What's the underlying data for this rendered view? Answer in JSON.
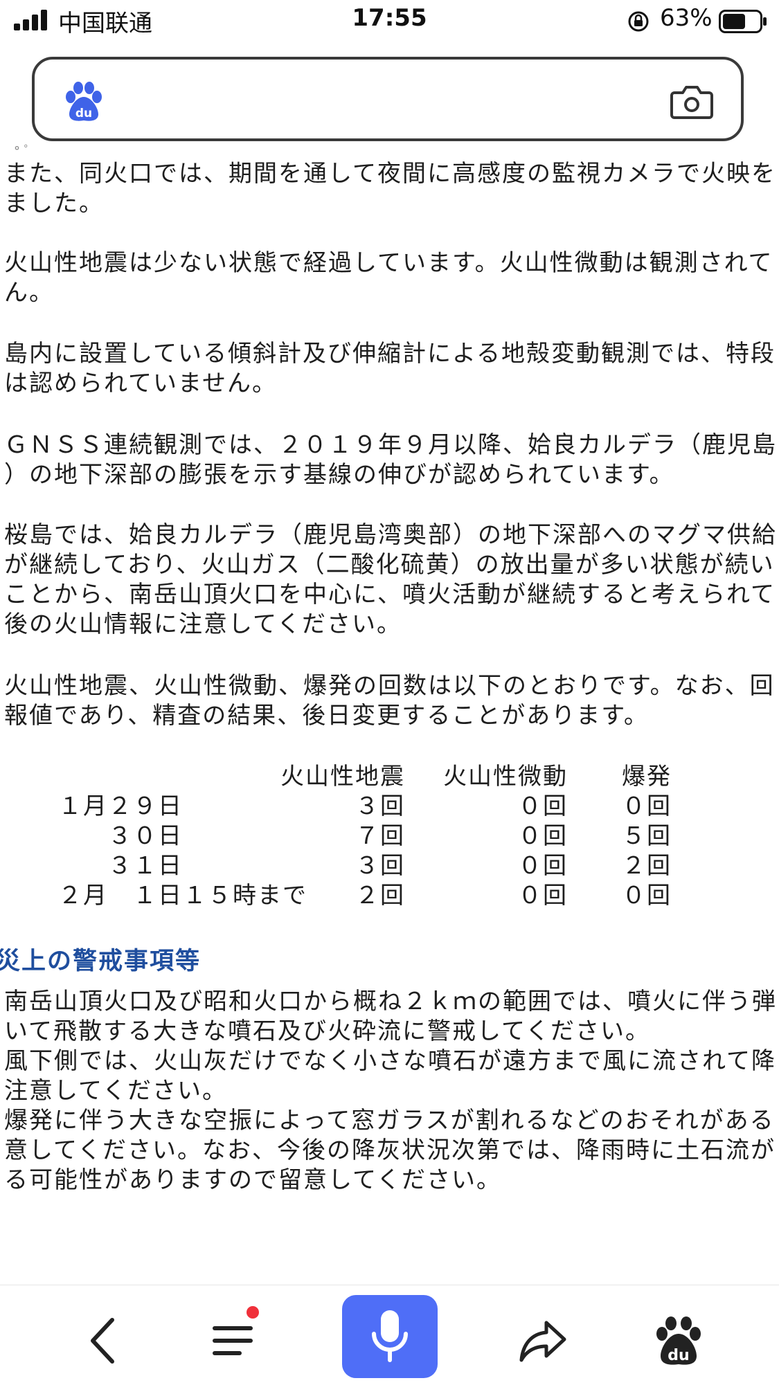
{
  "status_bar": {
    "carrier": "中国联通",
    "time": "17:55",
    "battery_percent": "63%",
    "battery_level": 0.63
  },
  "search": {
    "placeholder": ""
  },
  "content": {
    "paragraphs": [
      "また、同火口では、期間を通して夜間に高感度の監視カメラで火映を",
      "ました。",
      "火山性地震は少ない状態で経過しています。火山性微動は観測されて",
      "ん。",
      "島内に設置している傾斜計及び伸縮計による地殻変動観測では、特段",
      "は認められていません。",
      "ＧＮＳＳ連続観測では、２０１９年９月以降、姶良カルデラ（鹿児島",
      "）の地下深部の膨張を示す基線の伸びが認められています。",
      "桜島では、姶良カルデラ（鹿児島湾奥部）の地下深部へのマグマ供給",
      "が継続しており、火山ガス（二酸化硫黄）の放出量が多い状態が続い",
      "ことから、南岳山頂火口を中心に、噴火活動が継続すると考えられて",
      "後の火山情報に注意してください。",
      "火山性地震、火山性微動、爆発の回数は以下のとおりです。なお、回",
      "報値であり、精査の結果、後日変更することがあります。"
    ],
    "table": {
      "headers": [
        "火山性地震",
        "火山性微動",
        "爆発"
      ],
      "rows": [
        {
          "date": "１月２９日",
          "quakes": "３回",
          "tremors": "０回",
          "explosions": "０回"
        },
        {
          "date": "　　３０日",
          "quakes": "７回",
          "tremors": "０回",
          "explosions": "５回"
        },
        {
          "date": "　　３１日",
          "quakes": "３回",
          "tremors": "０回",
          "explosions": "２回"
        },
        {
          "date": "２月　１日１５時まで",
          "quakes": "２回",
          "tremors": "０回",
          "explosions": "０回"
        }
      ]
    },
    "heading": "災上の警戒事項等",
    "warnings": [
      "南岳山頂火口及び昭和火口から概ね２ｋｍの範囲では、噴火に伴う弾",
      "いて飛散する大きな噴石及び火砕流に警戒してください。",
      "風下側では、火山灰だけでなく小さな噴石が遠方まで風に流されて降",
      "注意してください。",
      "爆発に伴う大きな空振によって窓ガラスが割れるなどのおそれがある",
      "意してください。なお、今後の降灰状況次第では、降雨時に土石流が",
      "る可能性がありますので留意してください。"
    ]
  },
  "colors": {
    "accent": "#4f6ef7",
    "heading": "#1f4e9e",
    "badge": "#f0303a"
  },
  "icons": {
    "search_logo": "baidu-paw-icon",
    "camera": "camera-icon",
    "back": "chevron-left-icon",
    "menu": "menu-icon",
    "mic": "microphone-icon",
    "share": "share-icon",
    "home": "baidu-paw-icon"
  }
}
